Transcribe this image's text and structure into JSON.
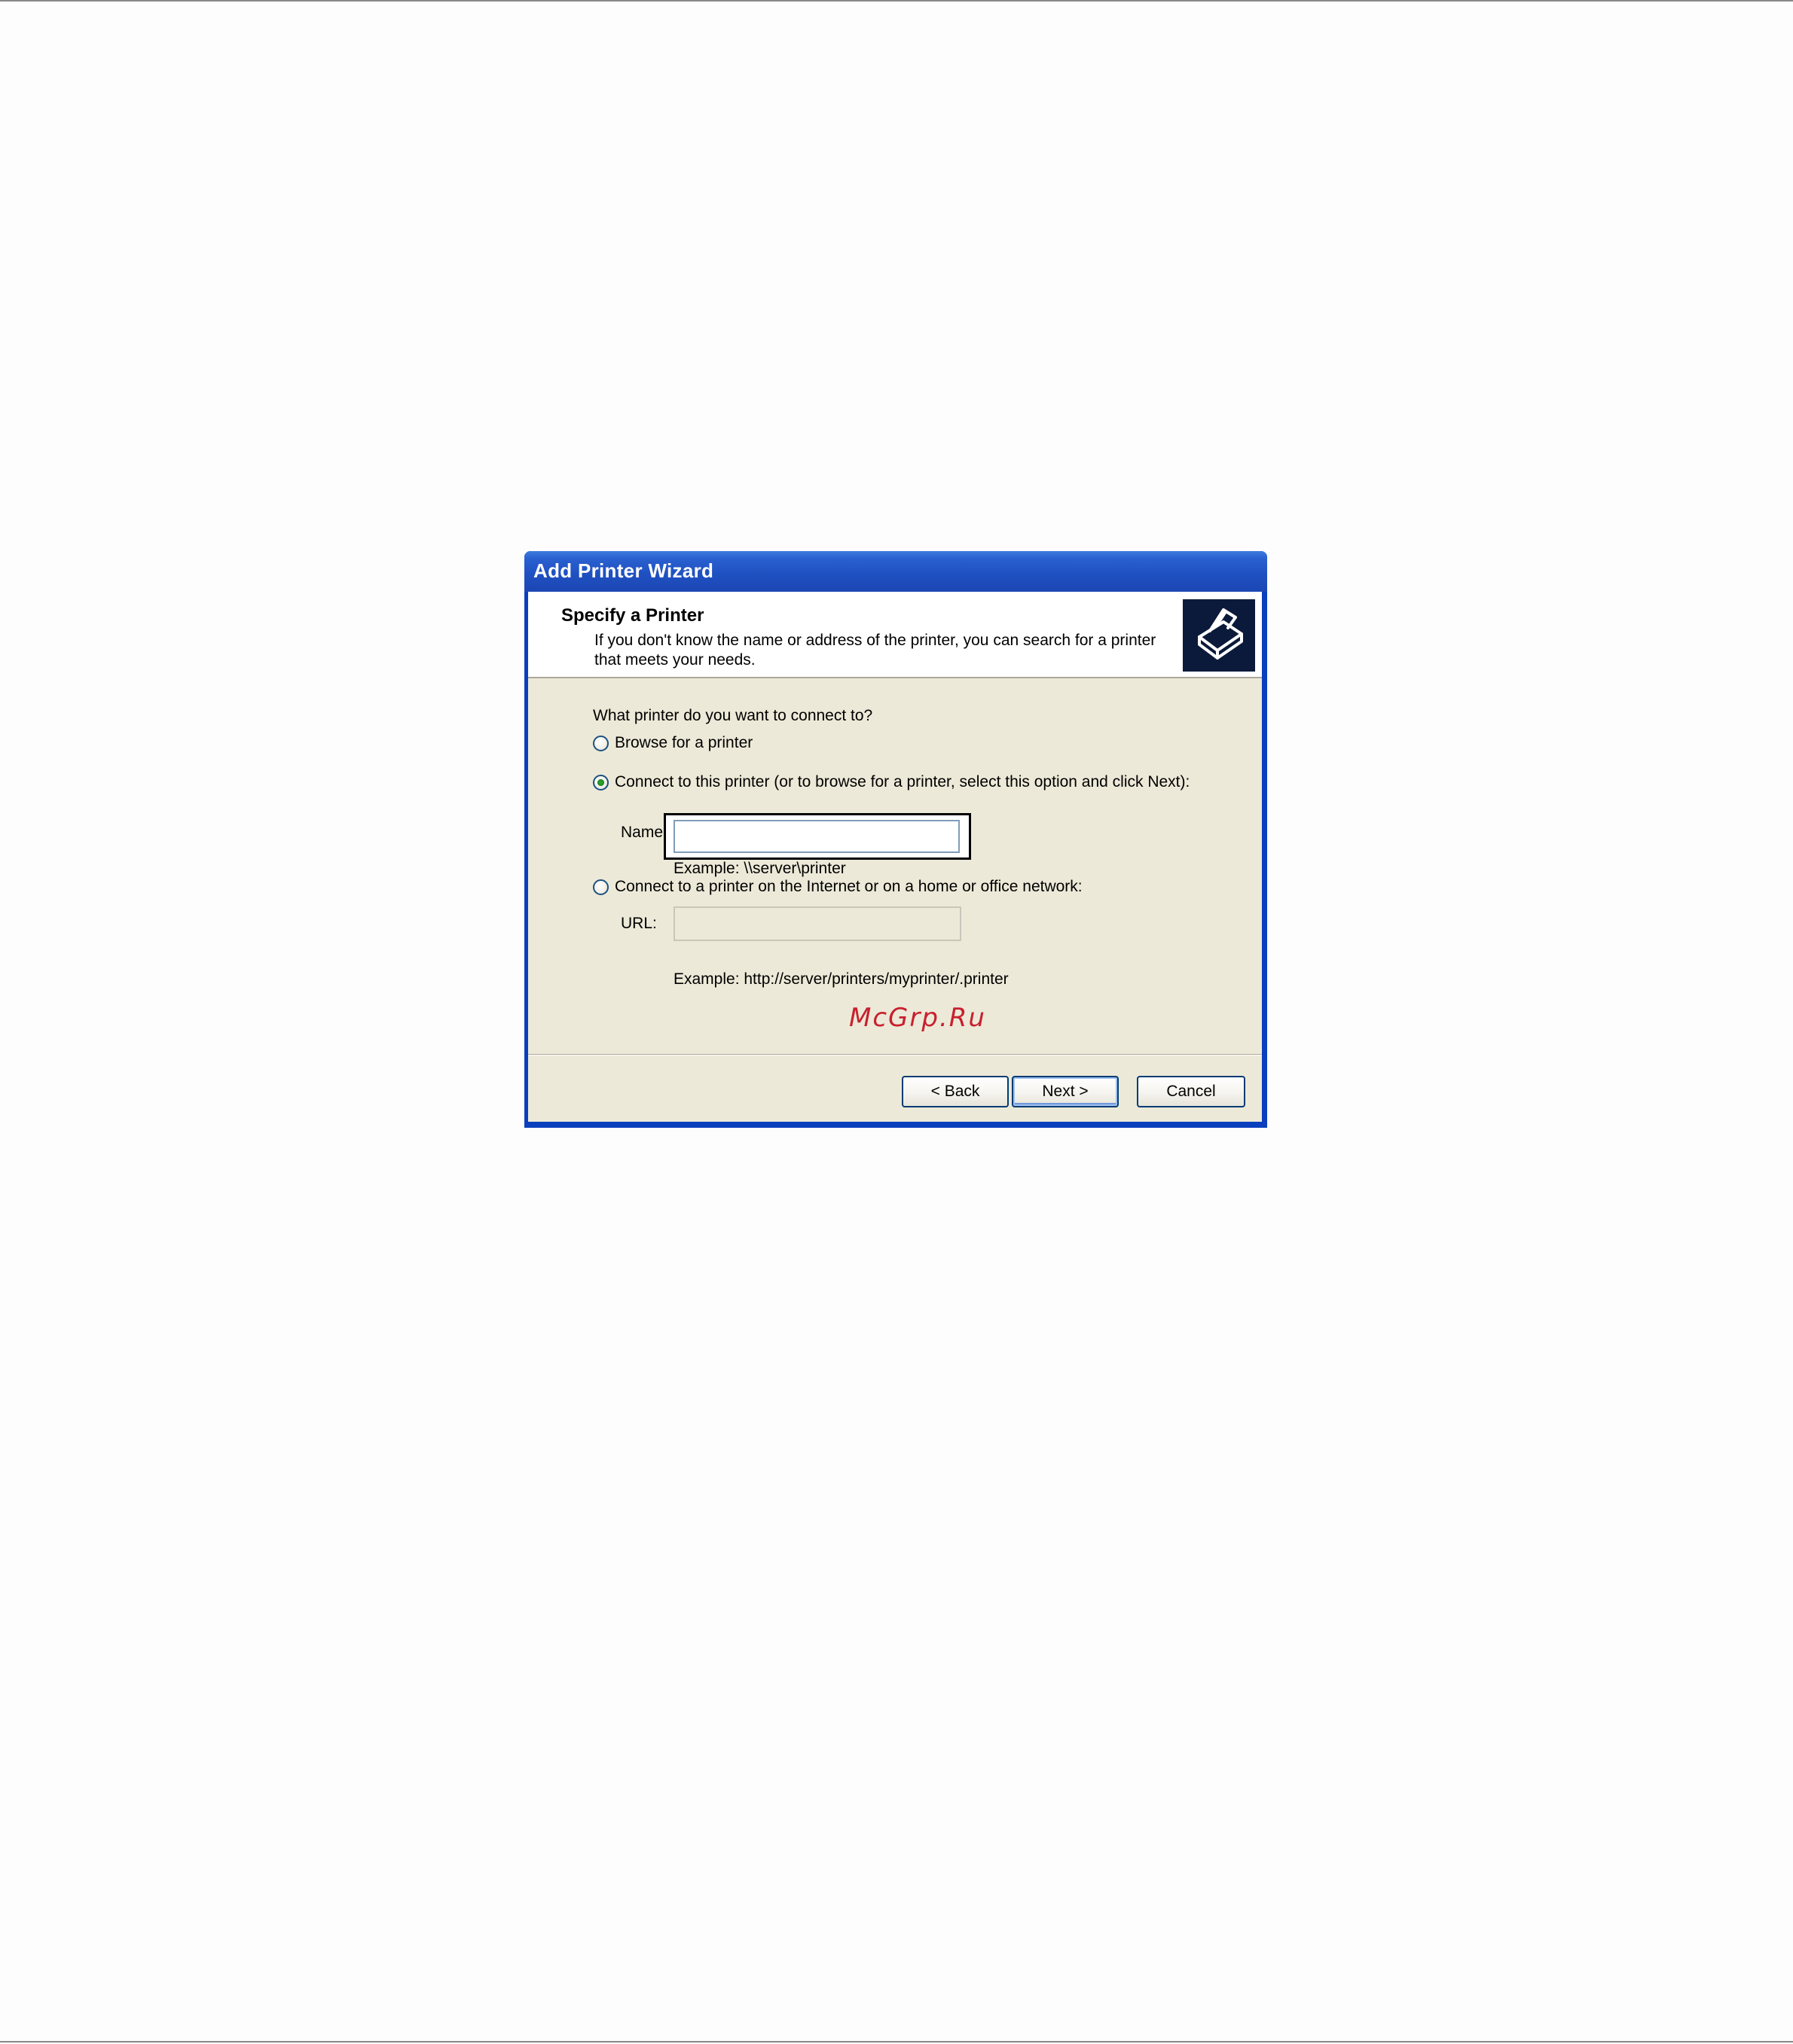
{
  "window": {
    "title": "Add Printer Wizard"
  },
  "header": {
    "title": "Specify a Printer",
    "subtitle_line1": "If you don't know the name or address of the printer, you can search for a printer",
    "subtitle_line2": "that meets your needs.",
    "icon": "printer-icon"
  },
  "body": {
    "question": "What printer do you want to connect to?",
    "options": [
      {
        "label": "Browse for a printer",
        "checked": false
      },
      {
        "label": "Connect to this printer (or to browse for a printer, select this option and click Next):",
        "checked": true
      },
      {
        "label": "Connect to a printer on the Internet or on a home or office network:",
        "checked": false
      }
    ],
    "name_label": "Name:",
    "name_value": "",
    "name_example": "Example: \\\\server\\printer",
    "url_label": "URL:",
    "url_value": "",
    "url_example": "Example: http://server/printers/myprinter/.printer"
  },
  "watermark": "McGrp.Ru",
  "buttons": {
    "back": "< Back",
    "next": "Next >",
    "cancel": "Cancel"
  },
  "colors": {
    "titlebar": "#1f4fc0",
    "dialog_face": "#ece9d8",
    "watermark": "#c8202e"
  }
}
